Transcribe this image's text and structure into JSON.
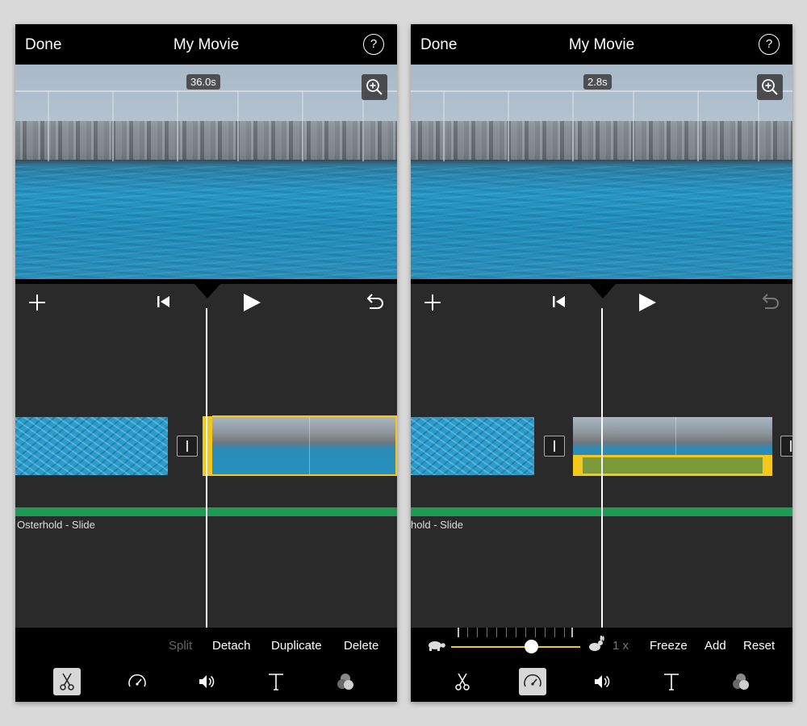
{
  "left": {
    "done_label": "Done",
    "title": "My Movie",
    "help_label": "?",
    "time_badge": "36.0s",
    "audio_label": "Osterhold - Slide",
    "actions": {
      "split": "Split",
      "detach": "Detach",
      "duplicate": "Duplicate",
      "delete": "Delete"
    },
    "active_tool": "scissors-icon"
  },
  "right": {
    "done_label": "Done",
    "title": "My Movie",
    "help_label": "?",
    "time_badge": "2.8s",
    "audio_label": "hold - Slide",
    "speed_value": "1 x",
    "actions": {
      "freeze": "Freeze",
      "add": "Add",
      "reset": "Reset"
    },
    "active_tool": "speedometer-icon",
    "speed_slider_level": 0.62
  },
  "colors": {
    "accent_yellow": "#f4c71b",
    "audio_green": "#1e9a55",
    "timeline_bg": "#2a2a2b"
  }
}
